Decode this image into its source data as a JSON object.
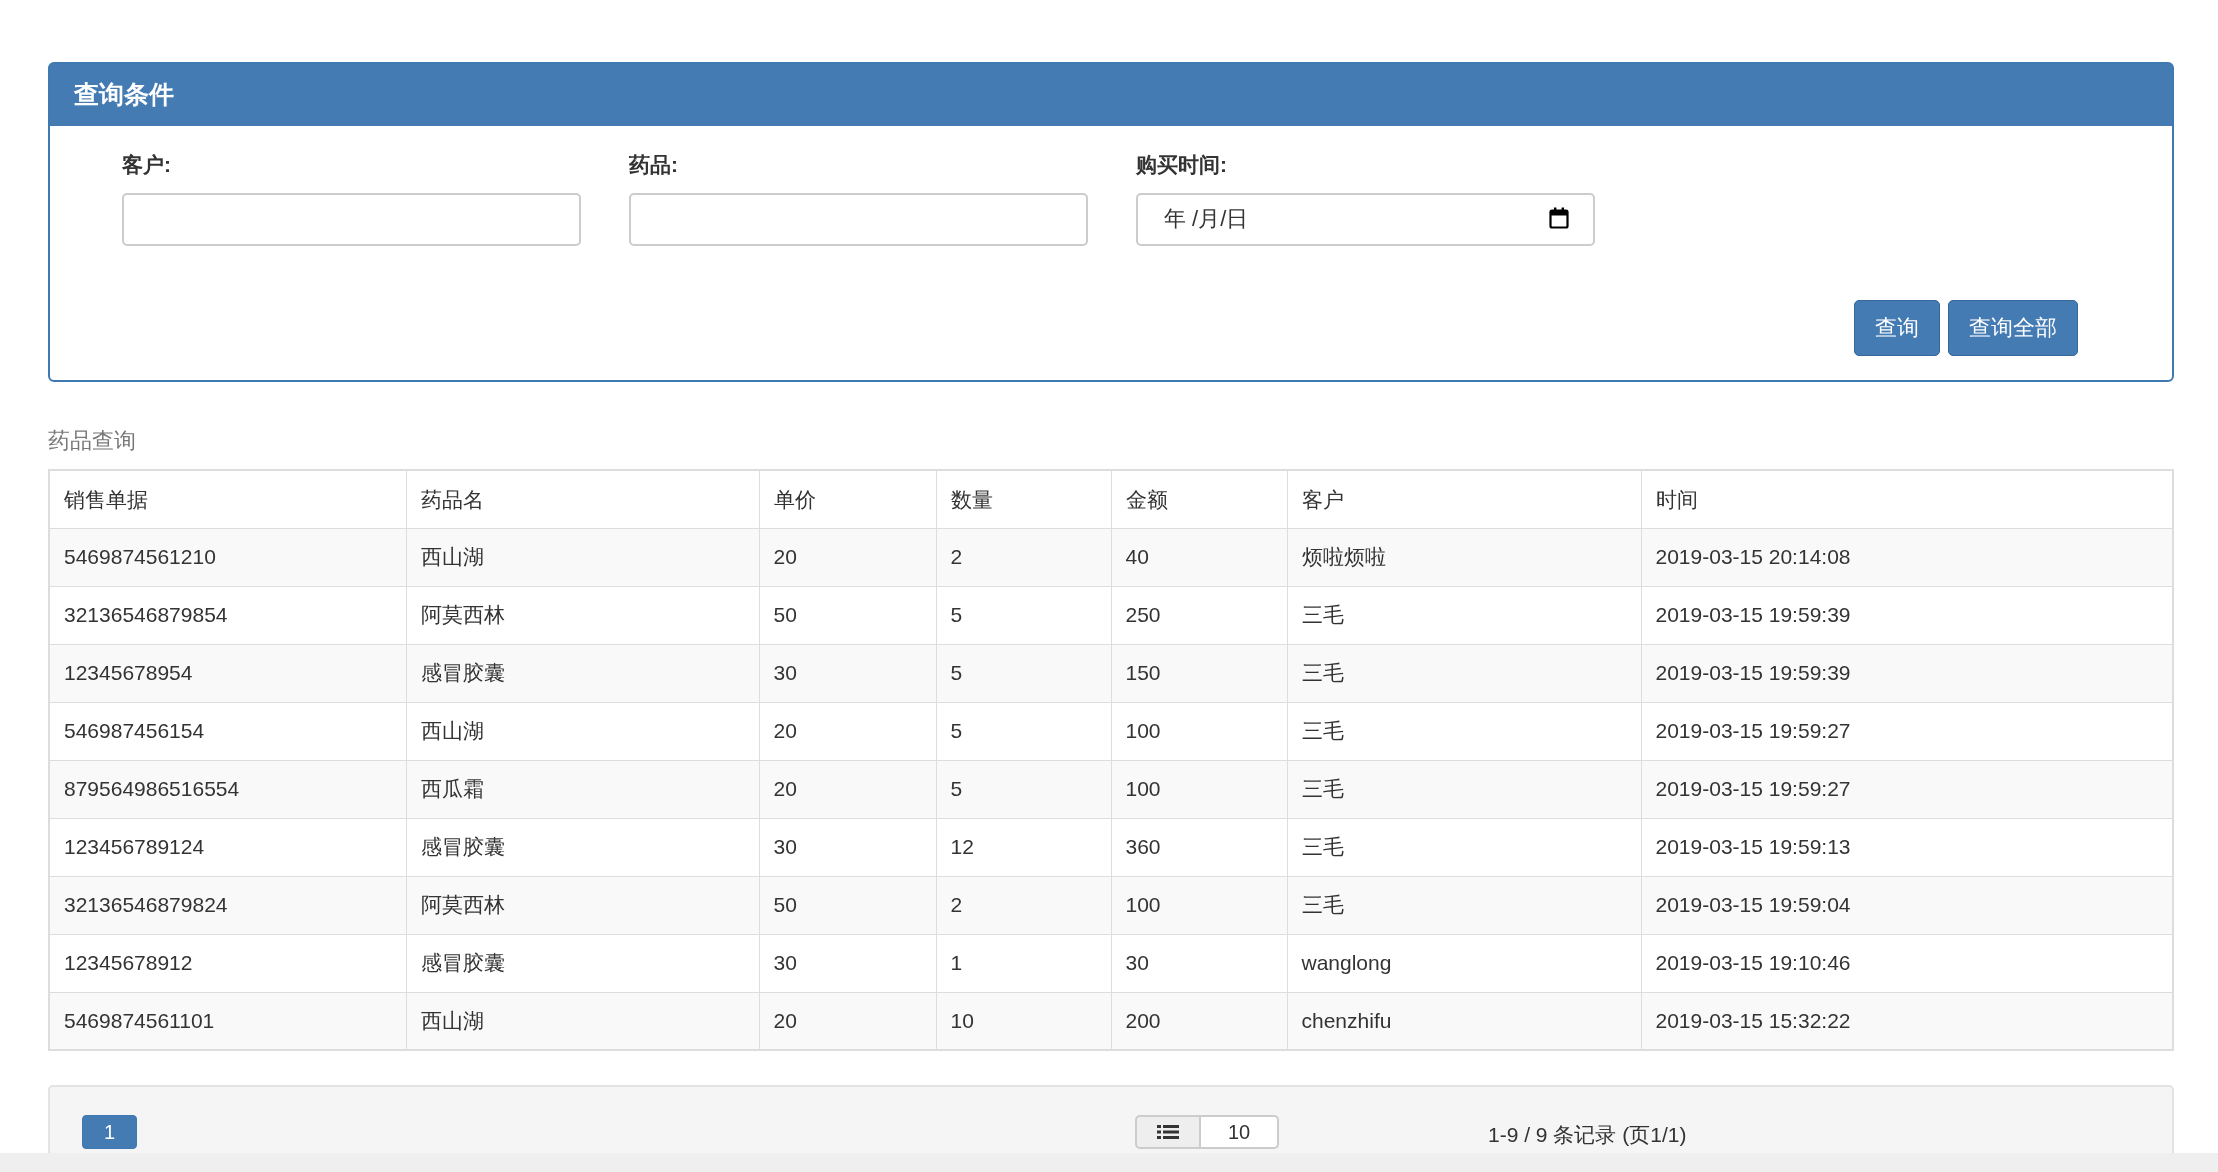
{
  "query_panel": {
    "title": "查询条件",
    "fields": [
      {
        "label": "客户:",
        "kind": "text"
      },
      {
        "label": "药品:",
        "kind": "text"
      },
      {
        "label": "购买时间:",
        "kind": "date",
        "placeholder": "年 /月/日"
      }
    ],
    "buttons": [
      "查询",
      "查询全部"
    ]
  },
  "table": {
    "caption": "药品查询",
    "columns": [
      "销售单据",
      "药品名",
      "单价",
      "数量",
      "金额",
      "客户",
      "时间"
    ],
    "rows": [
      [
        "5469874561210",
        "西山湖",
        "20",
        "2",
        "40",
        "烦啦烦啦",
        "2019-03-15 20:14:08"
      ],
      [
        "32136546879854",
        "阿莫西林",
        "50",
        "5",
        "250",
        "三毛",
        "2019-03-15 19:59:39"
      ],
      [
        "12345678954",
        "感冒胶囊",
        "30",
        "5",
        "150",
        "三毛",
        "2019-03-15 19:59:39"
      ],
      [
        "546987456154",
        "西山湖",
        "20",
        "5",
        "100",
        "三毛",
        "2019-03-15 19:59:27"
      ],
      [
        "879564986516554",
        "西瓜霜",
        "20",
        "5",
        "100",
        "三毛",
        "2019-03-15 19:59:27"
      ],
      [
        "123456789124",
        "感冒胶囊",
        "30",
        "12",
        "360",
        "三毛",
        "2019-03-15 19:59:13"
      ],
      [
        "32136546879824",
        "阿莫西林",
        "50",
        "2",
        "100",
        "三毛",
        "2019-03-15 19:59:04"
      ],
      [
        "12345678912",
        "感冒胶囊",
        "30",
        "1",
        "30",
        "wanglong",
        "2019-03-15 19:10:46"
      ],
      [
        "5469874561101",
        "西山湖",
        "20",
        "10",
        "200",
        "chenzhifu",
        "2019-03-15 15:32:22"
      ]
    ]
  },
  "pagination": {
    "pages": [
      {
        "label": "1",
        "selected": true
      }
    ],
    "page_size": "10",
    "summary": "1-9 / 9 条记录 (页1/1)"
  }
}
